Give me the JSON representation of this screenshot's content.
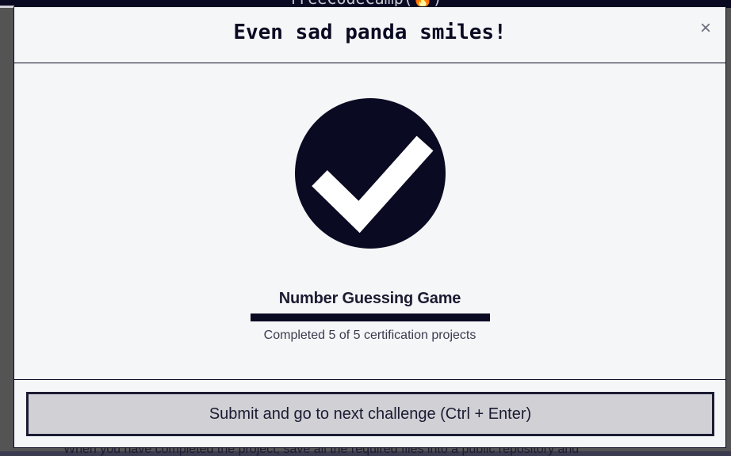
{
  "background": {
    "header_title": "freeCodeCamp(🔥)",
    "footer_text": "When you have completed the project, save all the required files into a public repository and"
  },
  "modal": {
    "title": "Even sad panda smiles!",
    "close_label": "×",
    "success_icon": "check-circle-icon",
    "project_title": "Number Guessing Game",
    "progress": {
      "completed": 5,
      "total": 5,
      "fraction": 1.0,
      "text": "Completed 5 of 5 certification projects"
    },
    "submit_label": "Submit and go to next challenge (Ctrl + Enter)"
  },
  "colors": {
    "primary_dark": "#0a0a23",
    "modal_bg": "#f5f6f7",
    "button_bg": "#d0d0d5",
    "backdrop": "#545454"
  }
}
